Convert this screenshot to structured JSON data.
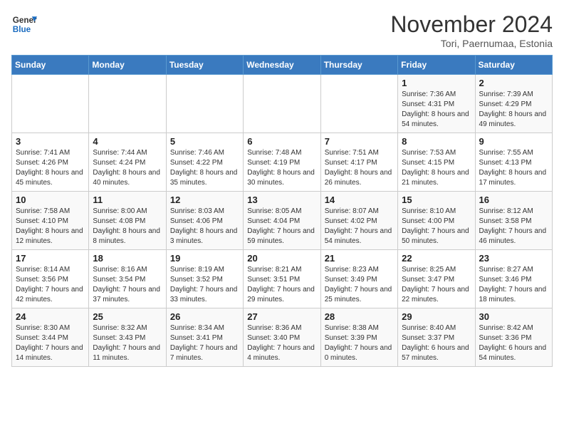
{
  "header": {
    "logo_line1": "General",
    "logo_line2": "Blue",
    "month": "November 2024",
    "location": "Tori, Paernumaa, Estonia"
  },
  "weekdays": [
    "Sunday",
    "Monday",
    "Tuesday",
    "Wednesday",
    "Thursday",
    "Friday",
    "Saturday"
  ],
  "weeks": [
    [
      {
        "day": "",
        "info": ""
      },
      {
        "day": "",
        "info": ""
      },
      {
        "day": "",
        "info": ""
      },
      {
        "day": "",
        "info": ""
      },
      {
        "day": "",
        "info": ""
      },
      {
        "day": "1",
        "info": "Sunrise: 7:36 AM\nSunset: 4:31 PM\nDaylight: 8 hours and 54 minutes."
      },
      {
        "day": "2",
        "info": "Sunrise: 7:39 AM\nSunset: 4:29 PM\nDaylight: 8 hours and 49 minutes."
      }
    ],
    [
      {
        "day": "3",
        "info": "Sunrise: 7:41 AM\nSunset: 4:26 PM\nDaylight: 8 hours and 45 minutes."
      },
      {
        "day": "4",
        "info": "Sunrise: 7:44 AM\nSunset: 4:24 PM\nDaylight: 8 hours and 40 minutes."
      },
      {
        "day": "5",
        "info": "Sunrise: 7:46 AM\nSunset: 4:22 PM\nDaylight: 8 hours and 35 minutes."
      },
      {
        "day": "6",
        "info": "Sunrise: 7:48 AM\nSunset: 4:19 PM\nDaylight: 8 hours and 30 minutes."
      },
      {
        "day": "7",
        "info": "Sunrise: 7:51 AM\nSunset: 4:17 PM\nDaylight: 8 hours and 26 minutes."
      },
      {
        "day": "8",
        "info": "Sunrise: 7:53 AM\nSunset: 4:15 PM\nDaylight: 8 hours and 21 minutes."
      },
      {
        "day": "9",
        "info": "Sunrise: 7:55 AM\nSunset: 4:13 PM\nDaylight: 8 hours and 17 minutes."
      }
    ],
    [
      {
        "day": "10",
        "info": "Sunrise: 7:58 AM\nSunset: 4:10 PM\nDaylight: 8 hours and 12 minutes."
      },
      {
        "day": "11",
        "info": "Sunrise: 8:00 AM\nSunset: 4:08 PM\nDaylight: 8 hours and 8 minutes."
      },
      {
        "day": "12",
        "info": "Sunrise: 8:03 AM\nSunset: 4:06 PM\nDaylight: 8 hours and 3 minutes."
      },
      {
        "day": "13",
        "info": "Sunrise: 8:05 AM\nSunset: 4:04 PM\nDaylight: 7 hours and 59 minutes."
      },
      {
        "day": "14",
        "info": "Sunrise: 8:07 AM\nSunset: 4:02 PM\nDaylight: 7 hours and 54 minutes."
      },
      {
        "day": "15",
        "info": "Sunrise: 8:10 AM\nSunset: 4:00 PM\nDaylight: 7 hours and 50 minutes."
      },
      {
        "day": "16",
        "info": "Sunrise: 8:12 AM\nSunset: 3:58 PM\nDaylight: 7 hours and 46 minutes."
      }
    ],
    [
      {
        "day": "17",
        "info": "Sunrise: 8:14 AM\nSunset: 3:56 PM\nDaylight: 7 hours and 42 minutes."
      },
      {
        "day": "18",
        "info": "Sunrise: 8:16 AM\nSunset: 3:54 PM\nDaylight: 7 hours and 37 minutes."
      },
      {
        "day": "19",
        "info": "Sunrise: 8:19 AM\nSunset: 3:52 PM\nDaylight: 7 hours and 33 minutes."
      },
      {
        "day": "20",
        "info": "Sunrise: 8:21 AM\nSunset: 3:51 PM\nDaylight: 7 hours and 29 minutes."
      },
      {
        "day": "21",
        "info": "Sunrise: 8:23 AM\nSunset: 3:49 PM\nDaylight: 7 hours and 25 minutes."
      },
      {
        "day": "22",
        "info": "Sunrise: 8:25 AM\nSunset: 3:47 PM\nDaylight: 7 hours and 22 minutes."
      },
      {
        "day": "23",
        "info": "Sunrise: 8:27 AM\nSunset: 3:46 PM\nDaylight: 7 hours and 18 minutes."
      }
    ],
    [
      {
        "day": "24",
        "info": "Sunrise: 8:30 AM\nSunset: 3:44 PM\nDaylight: 7 hours and 14 minutes."
      },
      {
        "day": "25",
        "info": "Sunrise: 8:32 AM\nSunset: 3:43 PM\nDaylight: 7 hours and 11 minutes."
      },
      {
        "day": "26",
        "info": "Sunrise: 8:34 AM\nSunset: 3:41 PM\nDaylight: 7 hours and 7 minutes."
      },
      {
        "day": "27",
        "info": "Sunrise: 8:36 AM\nSunset: 3:40 PM\nDaylight: 7 hours and 4 minutes."
      },
      {
        "day": "28",
        "info": "Sunrise: 8:38 AM\nSunset: 3:39 PM\nDaylight: 7 hours and 0 minutes."
      },
      {
        "day": "29",
        "info": "Sunrise: 8:40 AM\nSunset: 3:37 PM\nDaylight: 6 hours and 57 minutes."
      },
      {
        "day": "30",
        "info": "Sunrise: 8:42 AM\nSunset: 3:36 PM\nDaylight: 6 hours and 54 minutes."
      }
    ]
  ]
}
